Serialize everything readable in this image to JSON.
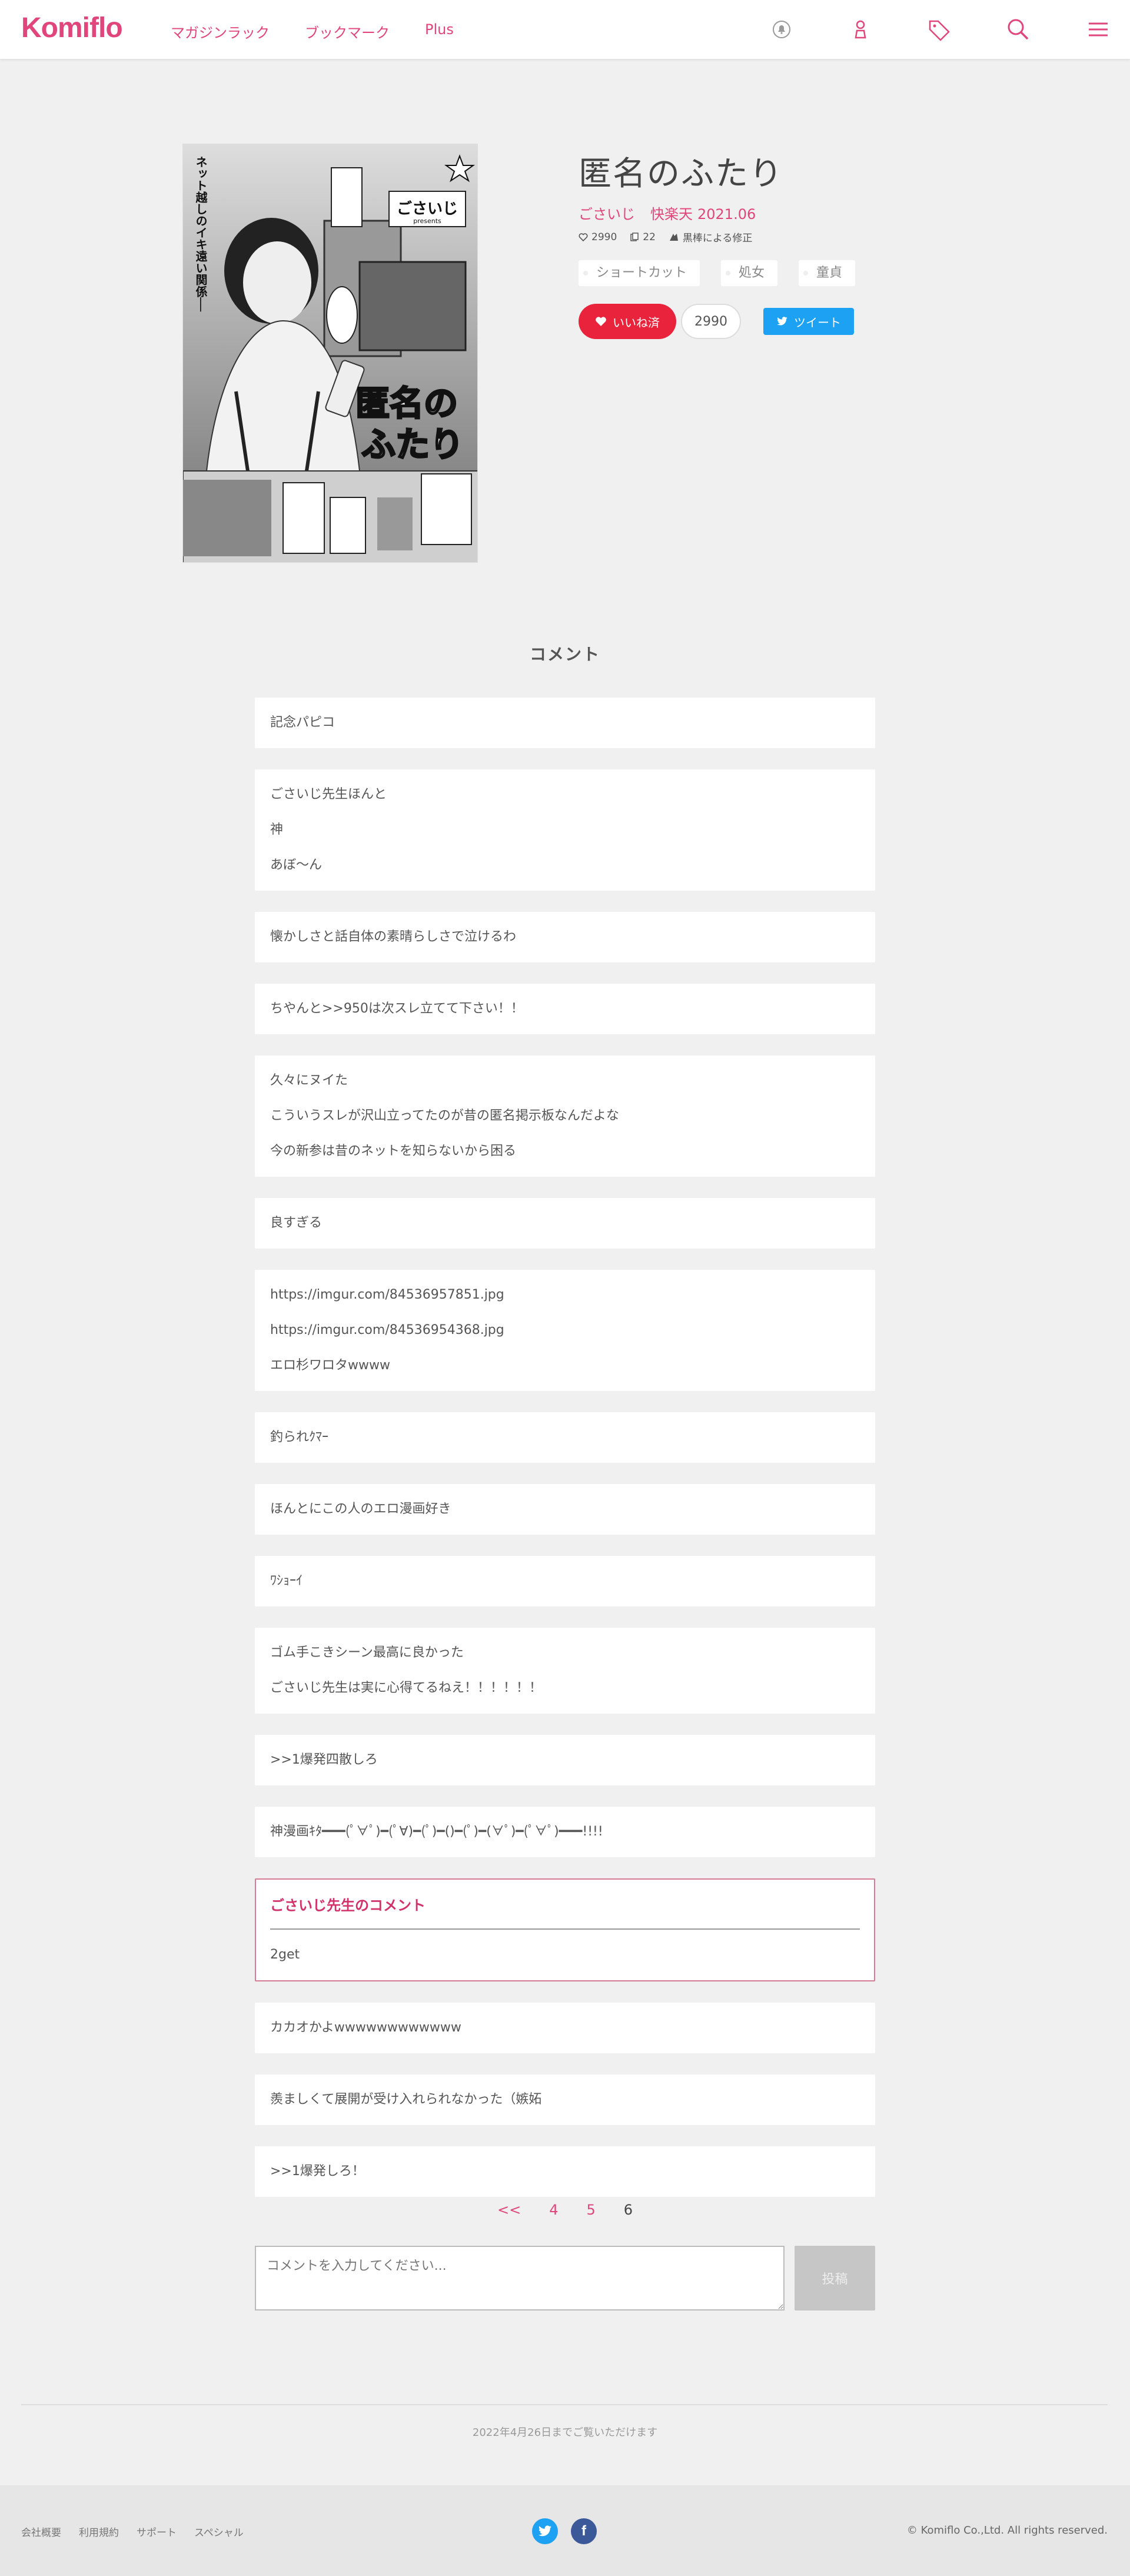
{
  "header": {
    "logo": "Komiflo",
    "nav": [
      "マガジンラック",
      "ブックマーク",
      "Plus"
    ],
    "icons": [
      "bell-icon",
      "user-icon",
      "tag-icon",
      "search-icon",
      "menu-icon"
    ]
  },
  "work": {
    "title": "匿名のふたり",
    "author": "ごさいじ",
    "magazine": "快楽天",
    "issue": "2021.06",
    "likes": "2990",
    "pages": "22",
    "correction": "黒棒による修正",
    "tags": [
      "ショートカット",
      "処女",
      "童貞"
    ],
    "like_button": "いいね済",
    "like_count": "2990",
    "tweet_button": "ツイート",
    "cover": {
      "headline": "ネット越しのイキ遠い関係──",
      "title_big": "匿名のふたり",
      "author_mark": "ごさいじ",
      "presents": "presents"
    }
  },
  "comments_title": "コメント",
  "comments": [
    {
      "lines": [
        "記念パピコ"
      ]
    },
    {
      "lines": [
        "ごさいじ先生ほんと",
        "神",
        "あぼ〜ん"
      ]
    },
    {
      "lines": [
        "懐かしさと話自体の素晴らしさで泣けるわ"
      ]
    },
    {
      "lines": [
        "ちやんと>>950は次スレ立てて下さい！！"
      ]
    },
    {
      "lines": [
        "久々にヌイた",
        "こういうスレが沢山立ってたのが昔の匿名掲示板なんだよな",
        "今の新参は昔のネットを知らないから困る"
      ]
    },
    {
      "lines": [
        "良すぎる"
      ]
    },
    {
      "lines": [
        "https://imgur.com/84536957851.jpg",
        "https://imgur.com/84536954368.jpg",
        "エロ杉ワロタwwww"
      ]
    },
    {
      "lines": [
        "釣られｸﾏｰ"
      ]
    },
    {
      "lines": [
        "ほんとにこの人のエロ漫画好き"
      ]
    },
    {
      "lines": [
        "ﾜｼｮｰｲ"
      ]
    },
    {
      "lines": [
        "ゴム手こきシーン最高に良かった",
        "ごさいじ先生は実に心得てるねえ！！！！！！"
      ]
    },
    {
      "lines": [
        ">>1爆発四散しろ"
      ]
    },
    {
      "lines": [
        "神漫画ｷﾀ━━━(ﾟ∀ﾟ)━(ﾟ∀)━(ﾟ)━()━(ﾟ)━(∀ﾟ)━(ﾟ∀ﾟ)━━━!!!!"
      ]
    },
    {
      "author": true,
      "heading": "ごさいじ先生のコメント",
      "lines": [
        "2get"
      ]
    },
    {
      "lines": [
        "カカオかよwwwwwwwwwwww"
      ]
    },
    {
      "lines": [
        "羨ましくて展開が受け入れられなかった（嫉妬"
      ]
    },
    {
      "lines": [
        ">>1爆発しろ！"
      ]
    }
  ],
  "pager": {
    "prev": "<<",
    "pages": [
      "4",
      "5"
    ],
    "current": "6"
  },
  "comment_form": {
    "placeholder": "コメントを入力してください...",
    "submit": "投稿"
  },
  "notice": "2022年4月26日までご覧いただけます",
  "footer": {
    "links": [
      "会社概要",
      "利用規約",
      "サポート",
      "スペシャル"
    ],
    "copyright": "© Komiflo Co.,Ltd. All rights reserved.",
    "colors": {
      "twitter": "#1da1f2",
      "facebook": "#3b5998"
    }
  },
  "colors": {
    "accent": "#e0457b",
    "like": "#e8233b",
    "tweet": "#1da1f2"
  }
}
